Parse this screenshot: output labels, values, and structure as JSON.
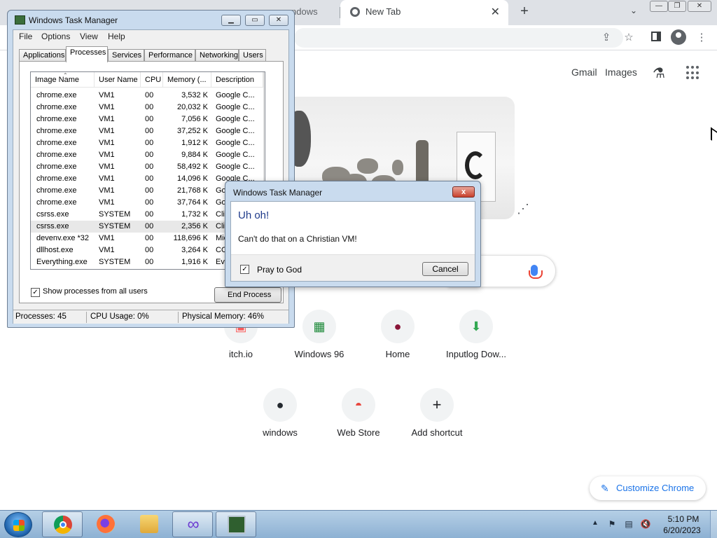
{
  "chrome": {
    "inactive_tab_title": "ndows",
    "active_tab_title": "New Tab",
    "tab_close": "✕",
    "new_tab": "+",
    "tab_search": "⌄",
    "win_minimize": "—",
    "win_restore": "❐",
    "win_close": "✕",
    "share_icon": "⇪",
    "star_icon": "☆",
    "menu_icon": "⋮"
  },
  "ntp": {
    "gmail": "Gmail",
    "images": "Images",
    "customize": "Customize Chrome",
    "shortcuts": [
      {
        "label": "itch.io",
        "icon": "itch-icon",
        "glyph": "▣",
        "color": "#fa5c5c"
      },
      {
        "label": "Windows 96",
        "icon": "windows96-icon",
        "glyph": "▦",
        "color": "#1e8a3a"
      },
      {
        "label": "Home",
        "icon": "home-dots-icon",
        "glyph": "●",
        "color": "#8a1538"
      },
      {
        "label": "Inputlog Dow...",
        "icon": "download-icon",
        "glyph": "⬇",
        "color": "#33a852"
      },
      {
        "label": "windows",
        "icon": "github-icon",
        "glyph": "●",
        "color": "#24292f"
      },
      {
        "label": "Web Store",
        "icon": "webstore-icon",
        "glyph": "◓",
        "color": "#e8453c"
      },
      {
        "label": "Add shortcut",
        "icon": "plus-icon",
        "glyph": "+",
        "color": "#202124"
      }
    ]
  },
  "task_manager": {
    "title": "Windows Task Manager",
    "menu": [
      "File",
      "Options",
      "View",
      "Help"
    ],
    "tabs": [
      "Applications",
      "Processes",
      "Services",
      "Performance",
      "Networking",
      "Users"
    ],
    "active_tab": "Processes",
    "columns": [
      "Image Name",
      "User Name",
      "CPU",
      "Memory (...",
      "Description"
    ],
    "rows": [
      {
        "name": "chrome.exe",
        "user": "VM1",
        "cpu": "00",
        "mem": "3,532 K",
        "desc": "Google C..."
      },
      {
        "name": "chrome.exe",
        "user": "VM1",
        "cpu": "00",
        "mem": "20,032 K",
        "desc": "Google C..."
      },
      {
        "name": "chrome.exe",
        "user": "VM1",
        "cpu": "00",
        "mem": "7,056 K",
        "desc": "Google C..."
      },
      {
        "name": "chrome.exe",
        "user": "VM1",
        "cpu": "00",
        "mem": "37,252 K",
        "desc": "Google C..."
      },
      {
        "name": "chrome.exe",
        "user": "VM1",
        "cpu": "00",
        "mem": "1,912 K",
        "desc": "Google C..."
      },
      {
        "name": "chrome.exe",
        "user": "VM1",
        "cpu": "00",
        "mem": "9,884 K",
        "desc": "Google C..."
      },
      {
        "name": "chrome.exe",
        "user": "VM1",
        "cpu": "00",
        "mem": "58,492 K",
        "desc": "Google C..."
      },
      {
        "name": "chrome.exe",
        "user": "VM1",
        "cpu": "00",
        "mem": "14,096 K",
        "desc": "Google C..."
      },
      {
        "name": "chrome.exe",
        "user": "VM1",
        "cpu": "00",
        "mem": "21,768 K",
        "desc": "Goo"
      },
      {
        "name": "chrome.exe",
        "user": "VM1",
        "cpu": "00",
        "mem": "37,764 K",
        "desc": "Goo"
      },
      {
        "name": "csrss.exe",
        "user": "SYSTEM",
        "cpu": "00",
        "mem": "1,732 K",
        "desc": "Clie"
      },
      {
        "name": "csrss.exe",
        "user": "SYSTEM",
        "cpu": "00",
        "mem": "2,356 K",
        "desc": "Clie"
      },
      {
        "name": "devenv.exe *32",
        "user": "VM1",
        "cpu": "00",
        "mem": "118,696 K",
        "desc": "Mic"
      },
      {
        "name": "dllhost.exe",
        "user": "VM1",
        "cpu": "00",
        "mem": "3,264 K",
        "desc": "CO"
      },
      {
        "name": "Everything.exe",
        "user": "SYSTEM",
        "cpu": "00",
        "mem": "1,916 K",
        "desc": "Eve"
      }
    ],
    "selected_row": 11,
    "show_all_users_label": "Show processes from all users",
    "show_all_users_checked": "✓",
    "end_process_label": "End Process",
    "status_processes": "Processes: 45",
    "status_cpu": "CPU Usage: 0%",
    "status_memory": "Physical Memory: 46%"
  },
  "dialog": {
    "title": "Windows Task Manager",
    "close": "x",
    "heading": "Uh oh!",
    "message": "Can't do that on a Christian VM!",
    "checkbox_label": "Pray to God",
    "checkbox_checked": "✓",
    "cancel": "Cancel"
  },
  "taskbar": {
    "time": "5:10 PM",
    "date": "6/20/2023",
    "tray_arrow": "▲"
  }
}
